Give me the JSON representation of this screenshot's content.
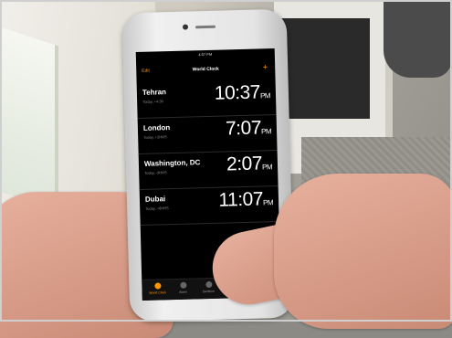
{
  "app": {
    "title": "World Clock",
    "edit_label": "Edit",
    "add_label": "+"
  },
  "status_bar": {
    "time": "4:07 PM"
  },
  "clocks": [
    {
      "city": "Tehran",
      "detail": "Today, +4:30",
      "time": "10:37",
      "period": "PM"
    },
    {
      "city": "London",
      "detail": "Today, +2HRS",
      "time": "7:07",
      "period": "PM"
    },
    {
      "city": "Washington, DC",
      "detail": "Today, -3HRS",
      "time": "2:07",
      "period": "PM"
    },
    {
      "city": "Dubai",
      "detail": "Today, +6HRS",
      "time": "11:07",
      "period": "PM"
    }
  ],
  "tabs": [
    {
      "label": "World Clock",
      "icon": "globe-icon"
    },
    {
      "label": "Alarm",
      "icon": "alarm-icon"
    },
    {
      "label": "Bedtime",
      "icon": "bed-icon"
    }
  ],
  "colors": {
    "accent": "#ff9500",
    "screen_bg": "#000000",
    "text": "#ffffff"
  }
}
